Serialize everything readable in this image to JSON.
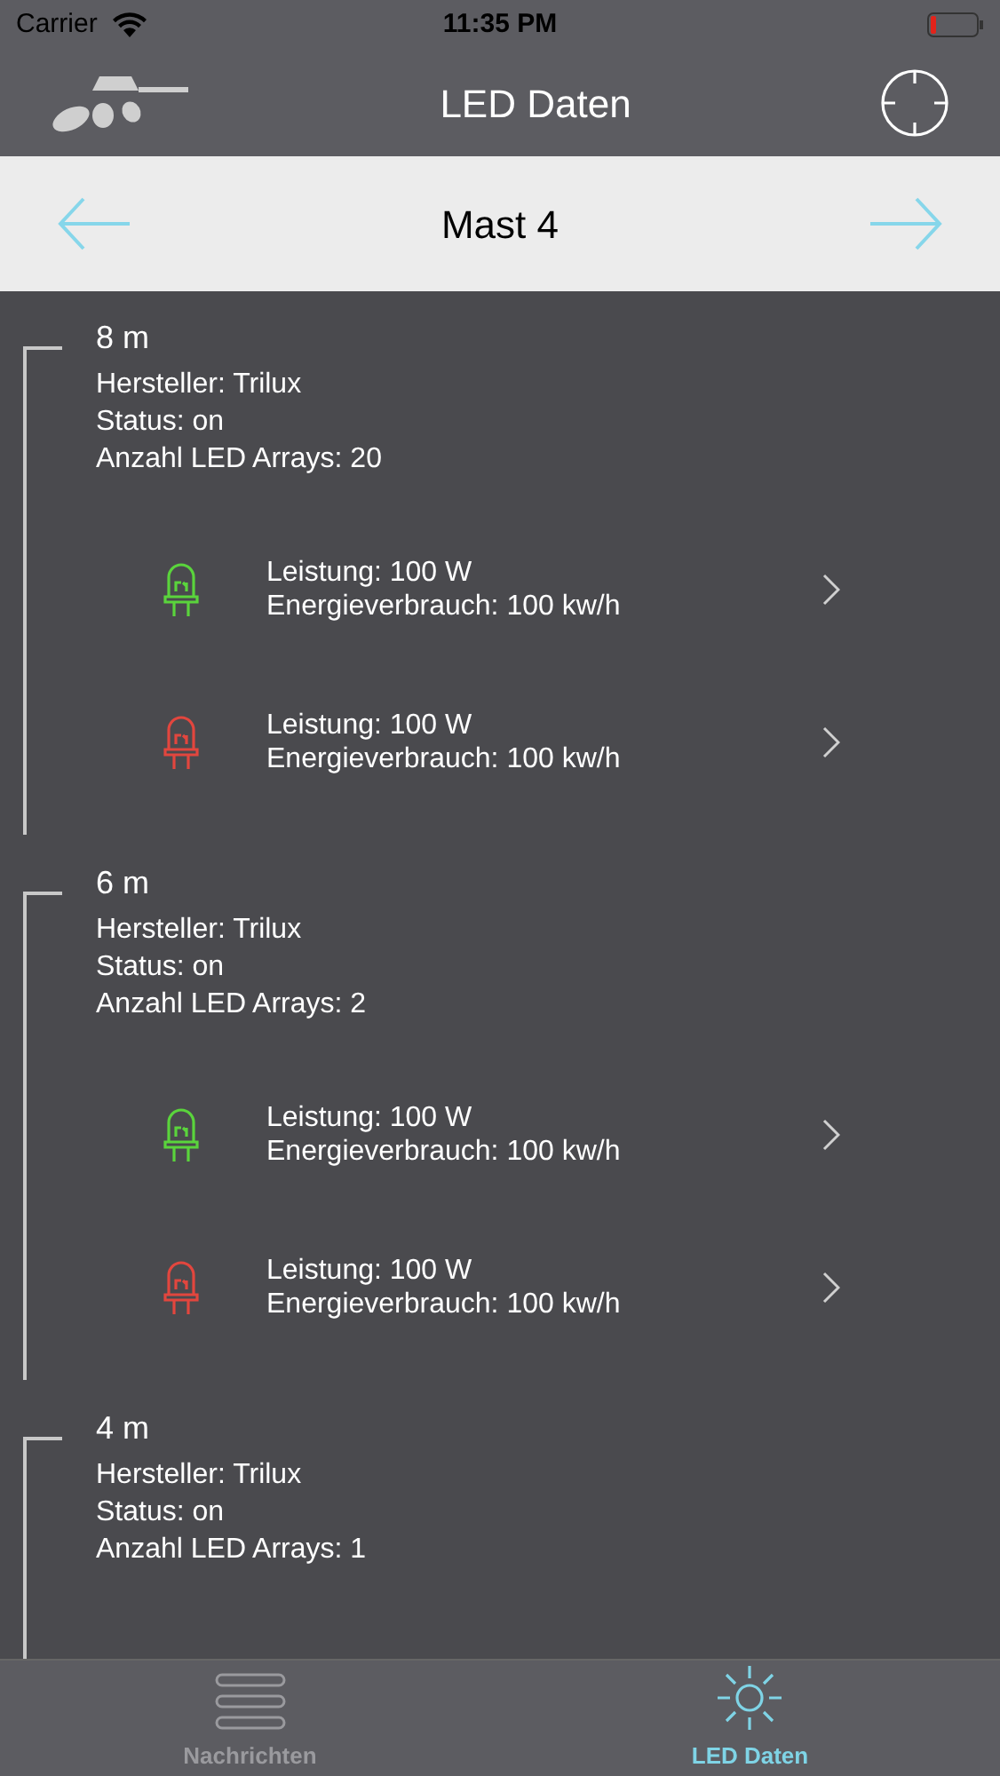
{
  "status_bar": {
    "carrier": "Carrier",
    "time": "11:35 PM"
  },
  "nav_bar": {
    "title": "LED Daten"
  },
  "mast_selector": {
    "title": "Mast 4"
  },
  "sections": [
    {
      "height": "8 m",
      "details": [
        "Hersteller: Trilux",
        "Status: on",
        "Anzahl LED Arrays: 20"
      ],
      "leds": [
        {
          "color": "#5ad43c",
          "lines": [
            "Leistung: 100 W",
            "Energieverbrauch: 100 kw/h"
          ]
        },
        {
          "color": "#e2463e",
          "lines": [
            "Leistung: 100 W",
            "Energieverbrauch: 100 kw/h"
          ]
        }
      ]
    },
    {
      "height": "6 m",
      "details": [
        "Hersteller: Trilux",
        "Status: on",
        "Anzahl LED Arrays: 2"
      ],
      "leds": [
        {
          "color": "#5ad43c",
          "lines": [
            "Leistung: 100 W",
            "Energieverbrauch: 100 kw/h"
          ]
        },
        {
          "color": "#e2463e",
          "lines": [
            "Leistung: 100 W",
            "Energieverbrauch: 100 kw/h"
          ]
        }
      ]
    },
    {
      "height": "4 m",
      "details": [
        "Hersteller: Trilux",
        "Status: on",
        "Anzahl LED Arrays: 1"
      ]
    }
  ],
  "tab_bar": [
    {
      "label": "Nachrichten",
      "kind": "messages",
      "selected": false
    },
    {
      "label": "LED Daten",
      "kind": "led",
      "selected": true
    }
  ]
}
